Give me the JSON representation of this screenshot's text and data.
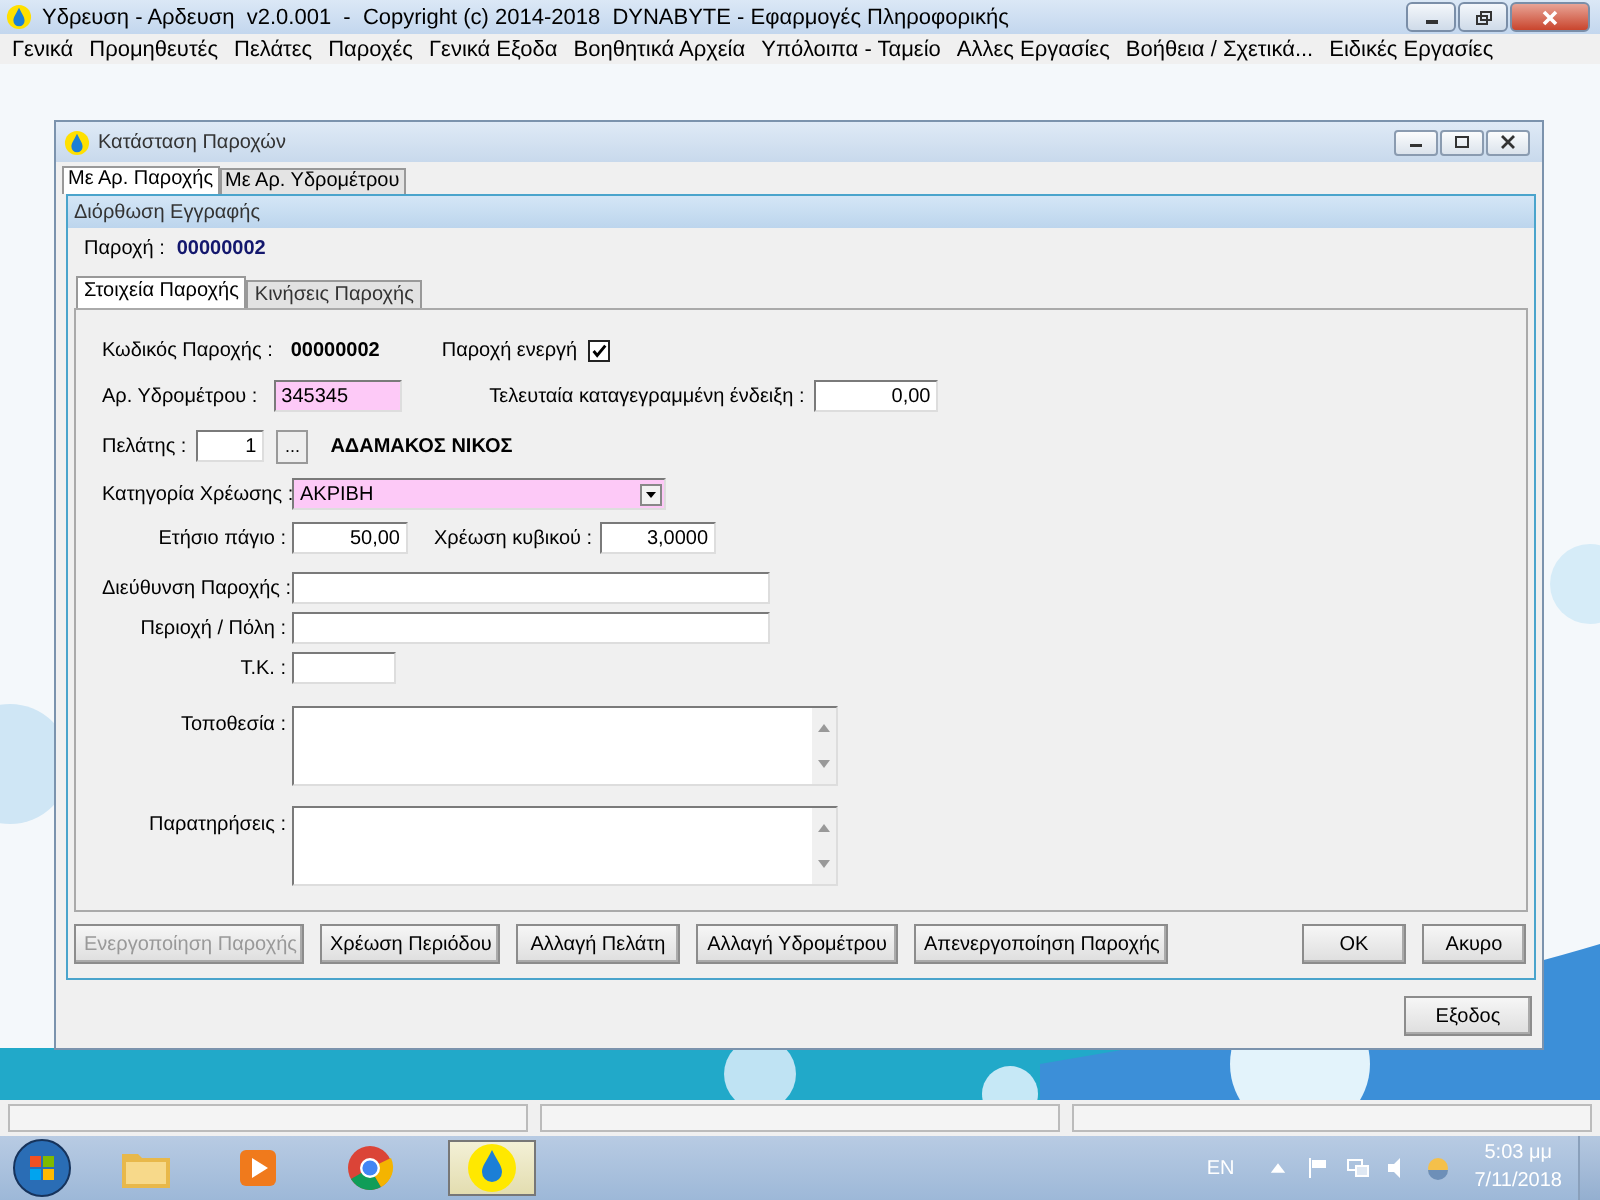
{
  "app": {
    "title": "Υδρευση - Αρδευση  v2.0.001  -  Copyright (c) 2014-2018  DYNABYTE - Εφαρμογές Πληροφορικής"
  },
  "menu": [
    "Γενικά",
    "Προμηθευτές",
    "Πελάτες",
    "Παροχές",
    "Γενικά Εξοδα",
    "Βοηθητικά Αρχεία",
    "Υπόλοιπα - Ταμείο",
    "Αλλες Εργασίες",
    "Βοήθεια / Σχετικά...",
    "Ειδικές Εργασίες"
  ],
  "list_window": {
    "title": "Κατάσταση Παροχών",
    "tabs": [
      {
        "label": "Με Αρ. Παροχής",
        "selected": true
      },
      {
        "label": "Με Αρ. Υδρομέτρου",
        "selected": false
      }
    ],
    "exit_button": "Εξοδος"
  },
  "dialog": {
    "title": "Διόρθωση Εγγραφής",
    "supply_label": "Παροχή :",
    "supply_number": "00000002",
    "tabs": [
      {
        "label": "Στοιχεία Παροχής",
        "selected": true
      },
      {
        "label": "Κινήσεις Παροχής",
        "selected": false
      }
    ],
    "code": {
      "label": "Κωδικός Παροχής :",
      "value": "00000002"
    },
    "active": {
      "label": "Παροχή ενεργή",
      "checked": true
    },
    "meter": {
      "label": "Αρ. Υδρομέτρου :",
      "value": "345345"
    },
    "last_reading": {
      "label": "Τελευταία καταγεγραμμένη ένδειξη :",
      "value": "0,00"
    },
    "customer": {
      "label": "Πελάτης :",
      "value": "1",
      "button": "...",
      "name": "ΑΔΑΜΑΚΟΣ ΝΙΚΟΣ"
    },
    "charge_category": {
      "label": "Κατηγορία Χρέωσης :",
      "value": "ΑΚΡΙΒΗ"
    },
    "annual_fee": {
      "label": "Ετήσιο πάγιο :",
      "value": "50,00"
    },
    "cubic_charge": {
      "label": "Χρέωση κυβικού :",
      "value": "3,0000"
    },
    "address": {
      "label": "Διεύθυνση Παροχής :"
    },
    "area": {
      "label": "Περιοχή / Πόλη :"
    },
    "zip": {
      "label": "Τ.Κ. :"
    },
    "location": {
      "label": "Τοποθεσία :"
    },
    "notes": {
      "label": "Παρατηρήσεις :"
    },
    "actions": [
      {
        "label": "Ενεργοποίηση Παροχής",
        "disabled": true
      },
      {
        "label": "Χρέωση Περιόδου",
        "disabled": false
      },
      {
        "label": "Αλλαγή Πελάτη",
        "disabled": false
      },
      {
        "label": "Αλλαγή Υδρομέτρου",
        "disabled": false
      },
      {
        "label": "Απενεργοποίηση Παροχής",
        "disabled": false
      }
    ],
    "ok": "OK",
    "cancel": "Ακυρο"
  },
  "taskbar": {
    "language": "EN",
    "time": "5:03 μμ",
    "date": "7/11/2018"
  }
}
